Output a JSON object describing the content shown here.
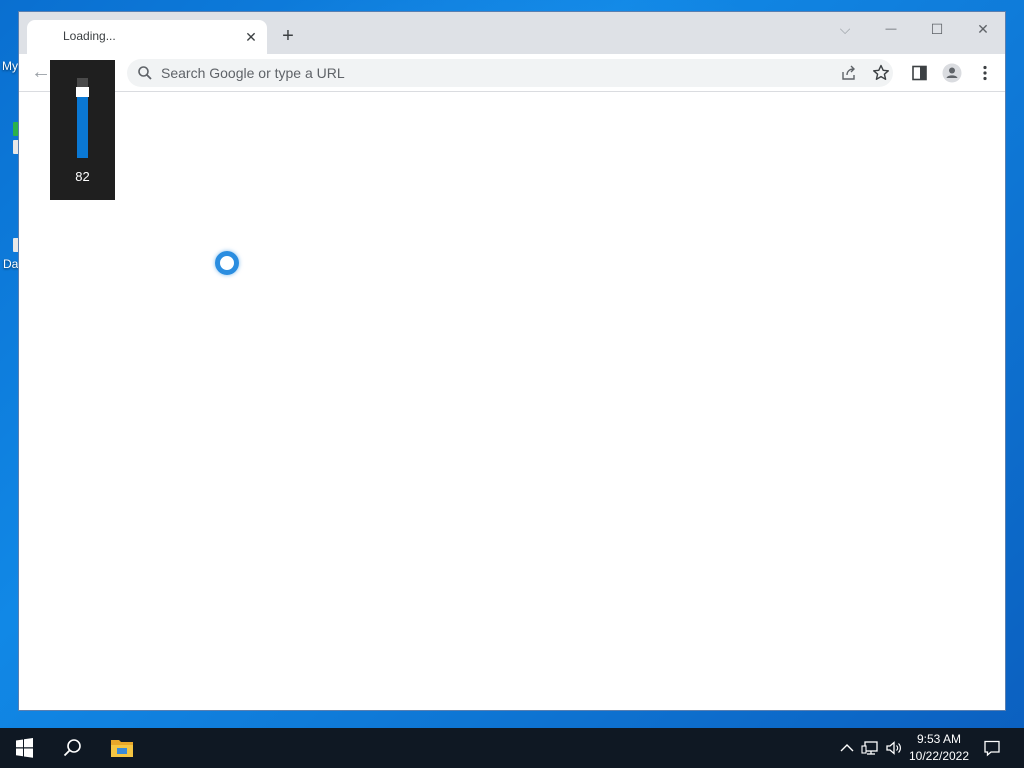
{
  "desktop": {
    "icon_labels": [
      "My",
      "Da"
    ]
  },
  "browser": {
    "tab": {
      "title": "Loading...",
      "close_glyph": "✕"
    },
    "new_tab_glyph": "+",
    "window_controls": {
      "tab_search": "⌵",
      "minimize": "—",
      "maximize": "☐",
      "close": "✕"
    },
    "toolbar": {
      "back_glyph": "←",
      "search_placeholder": "Search Google or type a URL",
      "icons": [
        "search-icon",
        "share-icon",
        "bookmark-star-icon",
        "side-panel-icon",
        "profile-icon",
        "kebab-menu-icon"
      ]
    },
    "content": {
      "state": "loading",
      "spinner_color": "#2a8de0"
    }
  },
  "volume_flyout": {
    "level": 82,
    "level_text": "82",
    "accent_color": "#0a78d4"
  },
  "taskbar": {
    "icons": [
      "windows-start-icon",
      "search-icon",
      "file-explorer-icon"
    ],
    "tray_icons": [
      "show-hidden-icons-icon",
      "network-icon",
      "volume-icon",
      "notifications-icon"
    ],
    "clock": {
      "time": "9:53 AM",
      "date": "10/22/2022"
    }
  }
}
